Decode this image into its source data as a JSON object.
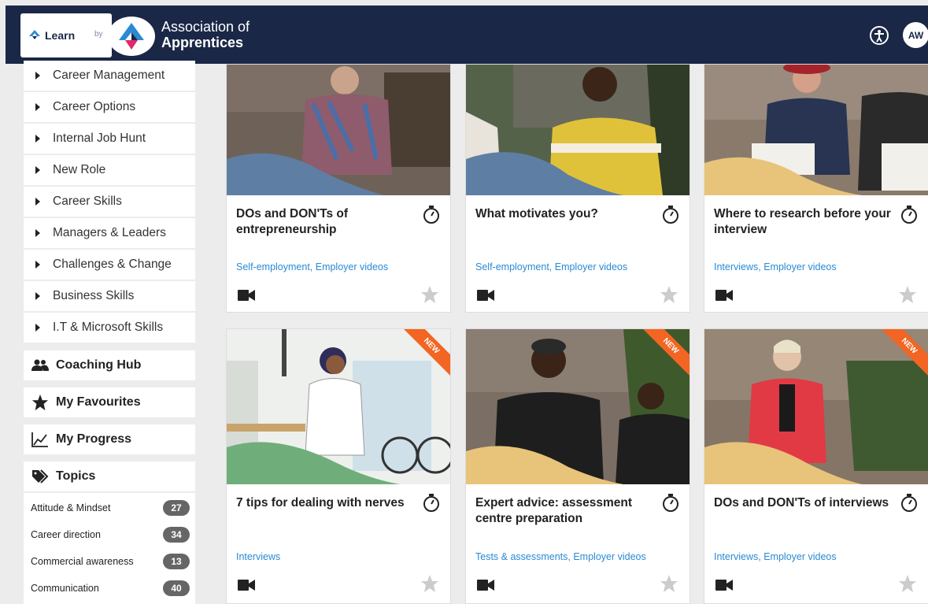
{
  "header": {
    "learn_label": "Learn",
    "by_label": "by",
    "org_line1": "Association of",
    "org_line2": "Apprentices",
    "avatar_initials": "AW"
  },
  "sidebar": {
    "categories": [
      {
        "label": "Career Management"
      },
      {
        "label": "Career Options"
      },
      {
        "label": "Internal Job Hunt"
      },
      {
        "label": "New Role"
      },
      {
        "label": "Career Skills"
      },
      {
        "label": "Managers & Leaders"
      },
      {
        "label": "Challenges & Change"
      },
      {
        "label": "Business Skills"
      },
      {
        "label": "I.T & Microsoft Skills"
      }
    ],
    "nav": [
      {
        "label": "Coaching Hub",
        "icon": "users-icon"
      },
      {
        "label": "My Favourites",
        "icon": "star-icon"
      },
      {
        "label": "My Progress",
        "icon": "chart-icon"
      },
      {
        "label": "Topics",
        "icon": "tags-icon"
      }
    ],
    "topics": [
      {
        "label": "Attitude & Mindset",
        "count": "27"
      },
      {
        "label": "Career direction",
        "count": "34"
      },
      {
        "label": "Commercial awareness",
        "count": "13"
      },
      {
        "label": "Communication",
        "count": "40"
      }
    ]
  },
  "cards": [
    {
      "title": "DOs and DON'Ts of entrepreneurship",
      "tags": "Self-employment, Employer videos",
      "new": false
    },
    {
      "title": "What motivates you?",
      "tags": "Self-employment, Employer videos",
      "new": false
    },
    {
      "title": "Where to research before your interview",
      "tags": "Interviews, Employer videos",
      "new": false
    },
    {
      "title": "7 tips for dealing with nerves",
      "tags": "Interviews",
      "new": true,
      "badge": "NEW"
    },
    {
      "title": "Expert advice: assessment centre preparation",
      "tags": "Tests & assessments, Employer videos",
      "new": true,
      "badge": "NEW"
    },
    {
      "title": "DOs and DON'Ts of interviews",
      "tags": "Interviews, Employer videos",
      "new": true,
      "badge": "NEW"
    }
  ],
  "colors": {
    "header_bg": "#1a2747",
    "link": "#2a8ad4",
    "new_ribbon": "#f26522"
  }
}
